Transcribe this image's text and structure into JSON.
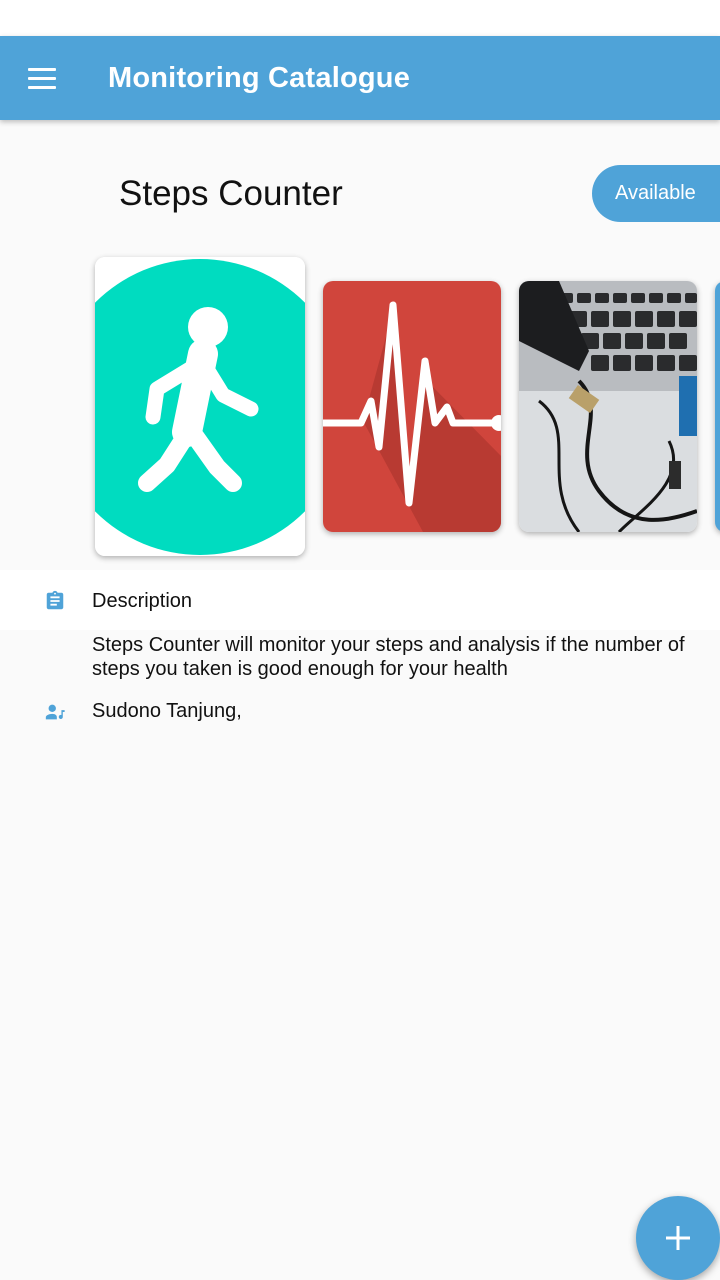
{
  "app_bar": {
    "title": "Monitoring Catalogue",
    "menu_icon": "hamburger-menu-icon",
    "color": "#4fa3d8"
  },
  "item": {
    "title": "Steps Counter",
    "status": "Available",
    "gallery": [
      {
        "name": "walking-person-image"
      },
      {
        "name": "heartbeat-pulse-image"
      },
      {
        "name": "laptop-usb-cable-photo"
      },
      {
        "name": "partial-card-image"
      }
    ]
  },
  "details": {
    "description_icon": "clipboard-icon",
    "description_heading": "Description",
    "description_text": "Steps Counter will monitor your steps and analysis if the number of steps you taken is good enough for your health",
    "author_icon": "person-icon",
    "author": "Sudono Tanjung,"
  },
  "fab": {
    "icon": "plus-icon",
    "color": "#4fa3d8"
  }
}
